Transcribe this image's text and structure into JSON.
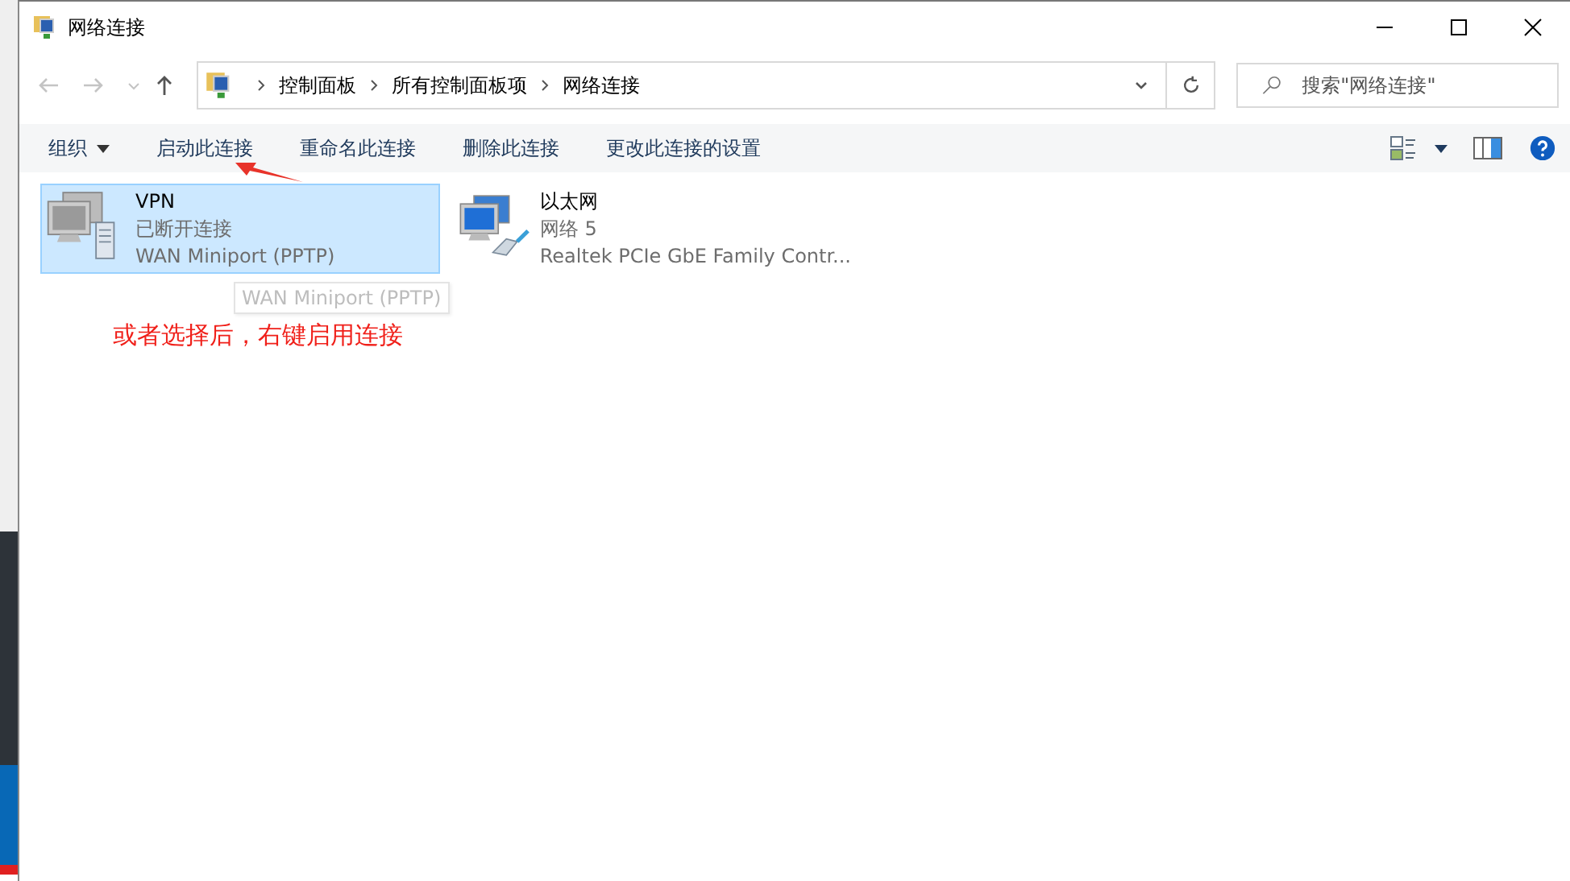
{
  "window": {
    "title": "网络连接"
  },
  "address_bar": {
    "breadcrumbs": [
      "控制面板",
      "所有控制面板项",
      "网络连接"
    ]
  },
  "search": {
    "placeholder": "搜索\"网络连接\""
  },
  "toolbar": [
    {
      "label": "组织",
      "kind": "menu"
    },
    {
      "label": "启动此连接",
      "kind": "command"
    },
    {
      "label": "重命名此连接",
      "kind": "command"
    },
    {
      "label": "删除此连接",
      "kind": "command"
    },
    {
      "label": "更改此连接的设置",
      "kind": "command"
    }
  ],
  "connections": [
    {
      "name": "VPN",
      "status": "已断开连接",
      "device": "WAN Miniport (PPTP)",
      "kind": "vpn",
      "selected": true
    },
    {
      "name": "以太网",
      "status": "网络 5",
      "device": "Realtek PCIe GbE Family Contr...",
      "kind": "ethernet",
      "selected": false
    }
  ],
  "tooltip": "WAN Miniport (PPTP)",
  "annotation": "或者选择后，右键启用连接"
}
